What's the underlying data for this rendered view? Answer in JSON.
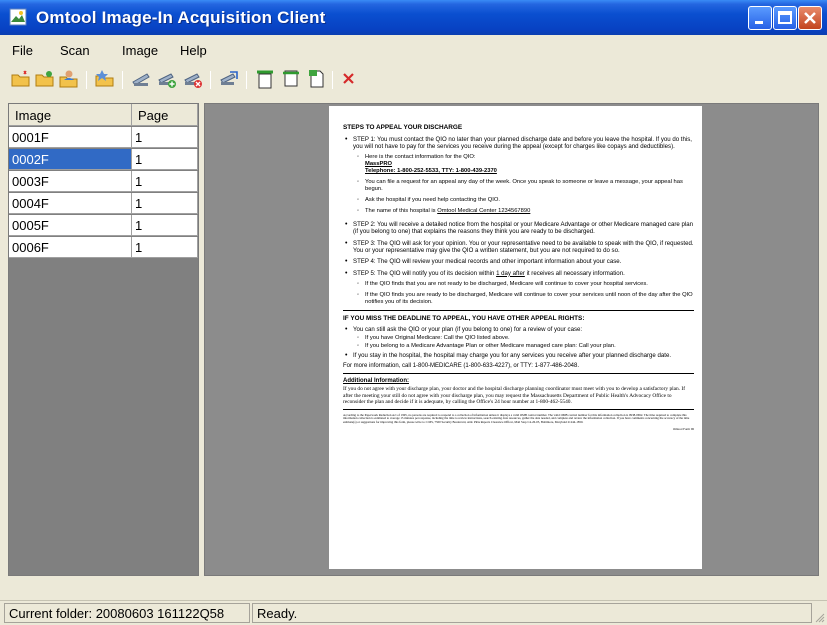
{
  "window": {
    "title": "Omtool Image-In Acquisition Client"
  },
  "menu": {
    "items": [
      "File",
      "Scan",
      "Image",
      "Help"
    ]
  },
  "toolbar": {
    "icons": [
      "open-folder-icon",
      "open-folder-add-icon",
      "user-folder-icon",
      "folder-star-icon",
      "scanner-icon",
      "scanner-add-icon",
      "scanner-delete-icon",
      "send-icon",
      "insert-before-icon",
      "insert-after-icon",
      "page-icon",
      "delete-icon"
    ]
  },
  "list": {
    "columns": [
      "Image",
      "Page"
    ],
    "rows": [
      {
        "image": "0001F",
        "page": "1"
      },
      {
        "image": "0002F",
        "page": "1"
      },
      {
        "image": "0003F",
        "page": "1"
      },
      {
        "image": "0004F",
        "page": "1"
      },
      {
        "image": "0005F",
        "page": "1"
      },
      {
        "image": "0006F",
        "page": "1"
      }
    ],
    "selected_index": 1
  },
  "document": {
    "heading": "STEPS TO APPEAL YOUR DISCHARGE",
    "step1": "STEP 1: You must contact the QIO no later than your planned discharge date and before you leave the hospital. If you do this, you will not have to pay for the services you receive during the appeal (except for charges like copays and deductibles).",
    "contact_intro": "Here is the contact information for the QIO:",
    "contact_name": "MassPRO",
    "contact_phone": "Telephone: 1-800-252-5533, TTY: 1-800-439-2370",
    "appeal_any_day": "You can file a request for an appeal any day of the week. Once you speak to someone or leave a message, your appeal has begun.",
    "ask_hospital": "Ask the hospital if you need help contacting the QIO.",
    "hospital_name_label": "The name of this hospital is",
    "hospital_name_value": "Omtool Medical Center  1234567890",
    "step2": "STEP 2: You will receive a detailed notice from the hospital or your Medicare Advantage or other Medicare managed care plan (if you belong to one) that explains the reasons they think you are ready to be discharged.",
    "step3": "STEP 3: The QIO will ask for your opinion. You or your representative need to be available to speak with the QIO, if requested. You or your representative may give the QIO a written statement, but you are not required to do so.",
    "step4": "STEP 4: The QIO will review your medical records and other important information about your case.",
    "step5_a": "STEP 5: The QIO will notify you of its decision within",
    "step5_u": "1 day after",
    "step5_b": "it receives all necessary information.",
    "step5_sub1": "If the QIO finds that you are not ready to be discharged, Medicare will continue to cover your hospital services.",
    "step5_sub2": "If the QIO finds you are ready to be discharged, Medicare will continue to cover your services until noon of the day after the QIO notifies you of its decision.",
    "heading2": "IF YOU MISS THE DEADLINE TO APPEAL, YOU HAVE OTHER APPEAL RIGHTS:",
    "miss1": "You can still ask the QIO or your plan (if you belong to one) for a review of your case:",
    "miss1_sub1": "If you have Original Medicare: Call the QIO listed above.",
    "miss1_sub2": "If you belong to a Medicare Advantage Plan or other Medicare managed care plan: Call your plan.",
    "miss2": "If you stay in the hospital, the hospital may charge you for any services you receive after your planned discharge date.",
    "more_info": "For more information, call 1-800-MEDICARE (1-800-633-4227), or TTY: 1-877-486-2048.",
    "additional_heading": "Additional Information:",
    "additional_body": "If you do not agree with your discharge plan, your doctor and the hospital discharge planning coordinator must meet with you to develop a satisfactory plan. If after the meeting your still do not agree with your discharge plan, you may request the Massachusetts Department of Public Health's Advocacy Office to reconsider the plan and decide if it is adequate, by calling the Office's 24 hour number at 1-800-462-5540.",
    "fine_print": "According to the Paperwork Reduction Act of 1995, no persons are required to respond to a collection of information unless it displays a valid OMB control number. The valid OMB control number for this information collection is 0938-0692. The time required to complete this information collection is estimated to average 15 minutes per response, including the time to review instructions, search existing data resources, gather the data needed, and complete and review the information collection. If you have comments concerning the accuracy of the time estimate(s) or suggestions for improving this form, please write to: CMS, 7500 Security Boulevard, Attn: PRA Reports Clearance Officer, Mail Stop C4-26-05, Baltimore, Maryland 21244-1850.",
    "footer_code": "Omtool Form ID"
  },
  "status": {
    "folder": "Current folder: 20080603 161122Q58",
    "state": "Ready."
  },
  "colors": {
    "titlebar": "#0a4fd0",
    "selection": "#316ac5",
    "workspace": "#8c8c8c"
  }
}
